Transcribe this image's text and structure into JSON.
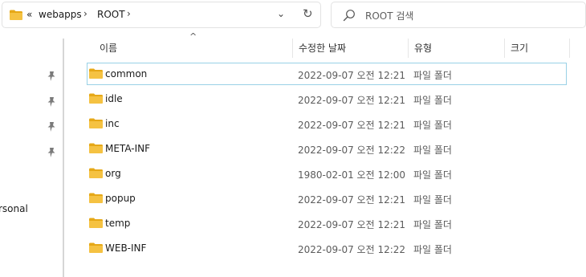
{
  "address_bar": {
    "overflow": "«",
    "path": [
      "webapps",
      "ROOT"
    ],
    "separator": "›",
    "dropdown_glyph": "⌄",
    "refresh_glyph": "↻"
  },
  "search": {
    "placeholder": "ROOT 검색"
  },
  "nav": {
    "visible_text": "rsonal",
    "pins": 4
  },
  "columns": {
    "sort_indicator": "^",
    "name": "이름",
    "date": "수정한 날짜",
    "type": "유형",
    "size": "크기"
  },
  "files": [
    {
      "name": "common",
      "date": "2022-09-07 오전 12:21",
      "type": "파일 폴더",
      "size": ""
    },
    {
      "name": "idle",
      "date": "2022-09-07 오전 12:21",
      "type": "파일 폴더",
      "size": ""
    },
    {
      "name": "inc",
      "date": "2022-09-07 오전 12:21",
      "type": "파일 폴더",
      "size": ""
    },
    {
      "name": "META-INF",
      "date": "2022-09-07 오전 12:22",
      "type": "파일 폴더",
      "size": ""
    },
    {
      "name": "org",
      "date": "1980-02-01 오전 12:00",
      "type": "파일 폴더",
      "size": ""
    },
    {
      "name": "popup",
      "date": "2022-09-07 오전 12:21",
      "type": "파일 폴더",
      "size": ""
    },
    {
      "name": "temp",
      "date": "2022-09-07 오전 12:21",
      "type": "파일 폴더",
      "size": ""
    },
    {
      "name": "WEB-INF",
      "date": "2022-09-07 오전 12:22",
      "type": "파일 폴더",
      "size": ""
    }
  ],
  "colors": {
    "folder": "#f5c242",
    "folder_dark": "#e6a817",
    "focus_border": "#99d1e6"
  }
}
